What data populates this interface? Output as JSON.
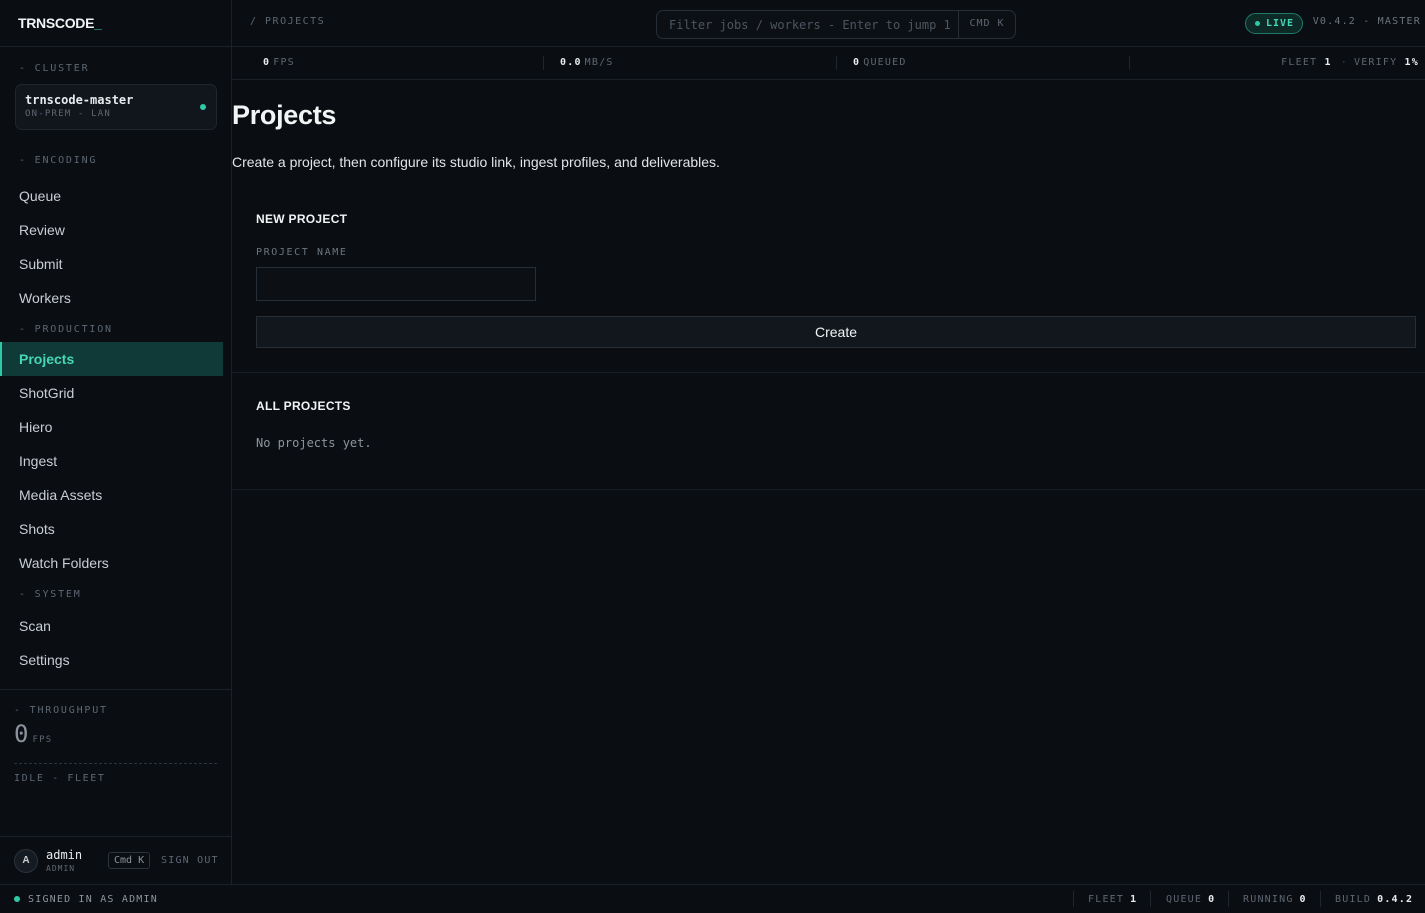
{
  "app": {
    "logo": "TRNSCODE",
    "logo_cursor": "_"
  },
  "sidebar": {
    "cluster_label": "- CLUSTER",
    "cluster": {
      "name": "trnscode-master",
      "sub": "ON-PREM - LAN"
    },
    "sections": [
      {
        "label": "- ENCODING",
        "items": [
          "Queue",
          "Review",
          "Submit",
          "Workers"
        ]
      },
      {
        "label": "- PRODUCTION",
        "items": [
          "Projects",
          "ShotGrid",
          "Hiero",
          "Ingest",
          "Media Assets",
          "Shots",
          "Watch Folders"
        ]
      },
      {
        "label": "- SYSTEM",
        "items": [
          "Scan",
          "Settings"
        ]
      }
    ],
    "active_item": "Projects",
    "throughput_label": "- THROUGHPUT",
    "throughput_value": "0",
    "throughput_unit": "FPS",
    "fleet_state": "IDLE - FLEET",
    "user": {
      "initial": "A",
      "name": "admin",
      "role": "ADMIN",
      "shortcut": "Cmd K",
      "signout": "SIGN OUT"
    }
  },
  "topbar": {
    "breadcrumb": "/ PROJECTS",
    "search_placeholder": "Filter jobs / workers - Enter to jump 1",
    "search_shortcut": "CMD K",
    "live_label": "LIVE",
    "version": "V0.4.2 - MASTER"
  },
  "stats": {
    "fps_value": "0",
    "fps_label": "FPS",
    "mbs_value": "0.0",
    "mbs_label": "MB/S",
    "queued_value": "0",
    "queued_label": "QUEUED",
    "fleet_label": "FLEET",
    "fleet_value": "1",
    "verify_label": "VERIFY",
    "verify_value": "1%"
  },
  "main": {
    "title": "Projects",
    "subtitle": "Create a project, then configure its studio link, ingest profiles, and deliverables.",
    "new_project_title": "NEW PROJECT",
    "project_name_label": "PROJECT NAME",
    "project_name_value": "",
    "create_label": "Create",
    "all_projects_title": "ALL PROJECTS",
    "empty_text": "No projects yet."
  },
  "footer": {
    "signed_in": "SIGNED IN AS ADMIN",
    "fleet_label": "FLEET",
    "fleet_value": "1",
    "queue_label": "QUEUE",
    "queue_value": "0",
    "running_label": "RUNNING",
    "running_value": "0",
    "build_label": "BUILD",
    "build_value": "0.4.2"
  },
  "colors": {
    "accent": "#2fc9a7",
    "background": "#0a0d11",
    "active_bg": "#0f3a38"
  }
}
